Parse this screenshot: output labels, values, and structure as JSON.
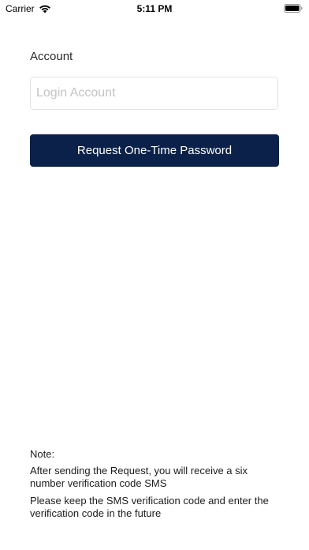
{
  "status_bar": {
    "carrier": "Carrier",
    "time": "5:11 PM",
    "wifi_icon": "wifi-icon",
    "battery_icon": "battery-icon"
  },
  "form": {
    "account_label": "Account",
    "account_placeholder": "Login Account",
    "account_value": "",
    "request_button_label": "Request One-Time Password"
  },
  "notes": {
    "title": "Note:",
    "line1": "After sending the Request, you will receive a six number verification code SMS",
    "line2": "Please keep the SMS verification code and enter the verification code in the future"
  },
  "colors": {
    "button_bg": "#0c2149",
    "button_text": "#ffffff",
    "input_border": "#e3e3e6",
    "placeholder": "#c4c4c7"
  }
}
